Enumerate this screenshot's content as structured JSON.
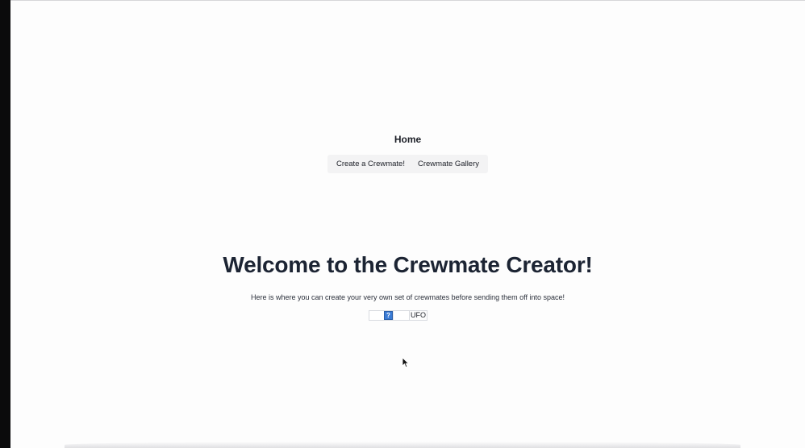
{
  "nav": {
    "title": "Home",
    "buttons": [
      "Create a Crewmate!",
      "Crewmate Gallery"
    ]
  },
  "hero": {
    "title": "Welcome to the Crewmate Creator!",
    "subtitle": "Here is where you can create your very own set of crewmates before sending them off into space!",
    "image_placeholder_glyph": "?",
    "image_alt": "UFO"
  },
  "colors": {
    "background": "#fdfdfd",
    "title_text": "#1c2433",
    "button_bg": "#f3f3f4",
    "broken_image_icon": "#3a7bd5"
  },
  "icons": [
    "broken-image-icon",
    "mouse-pointer-icon"
  ]
}
